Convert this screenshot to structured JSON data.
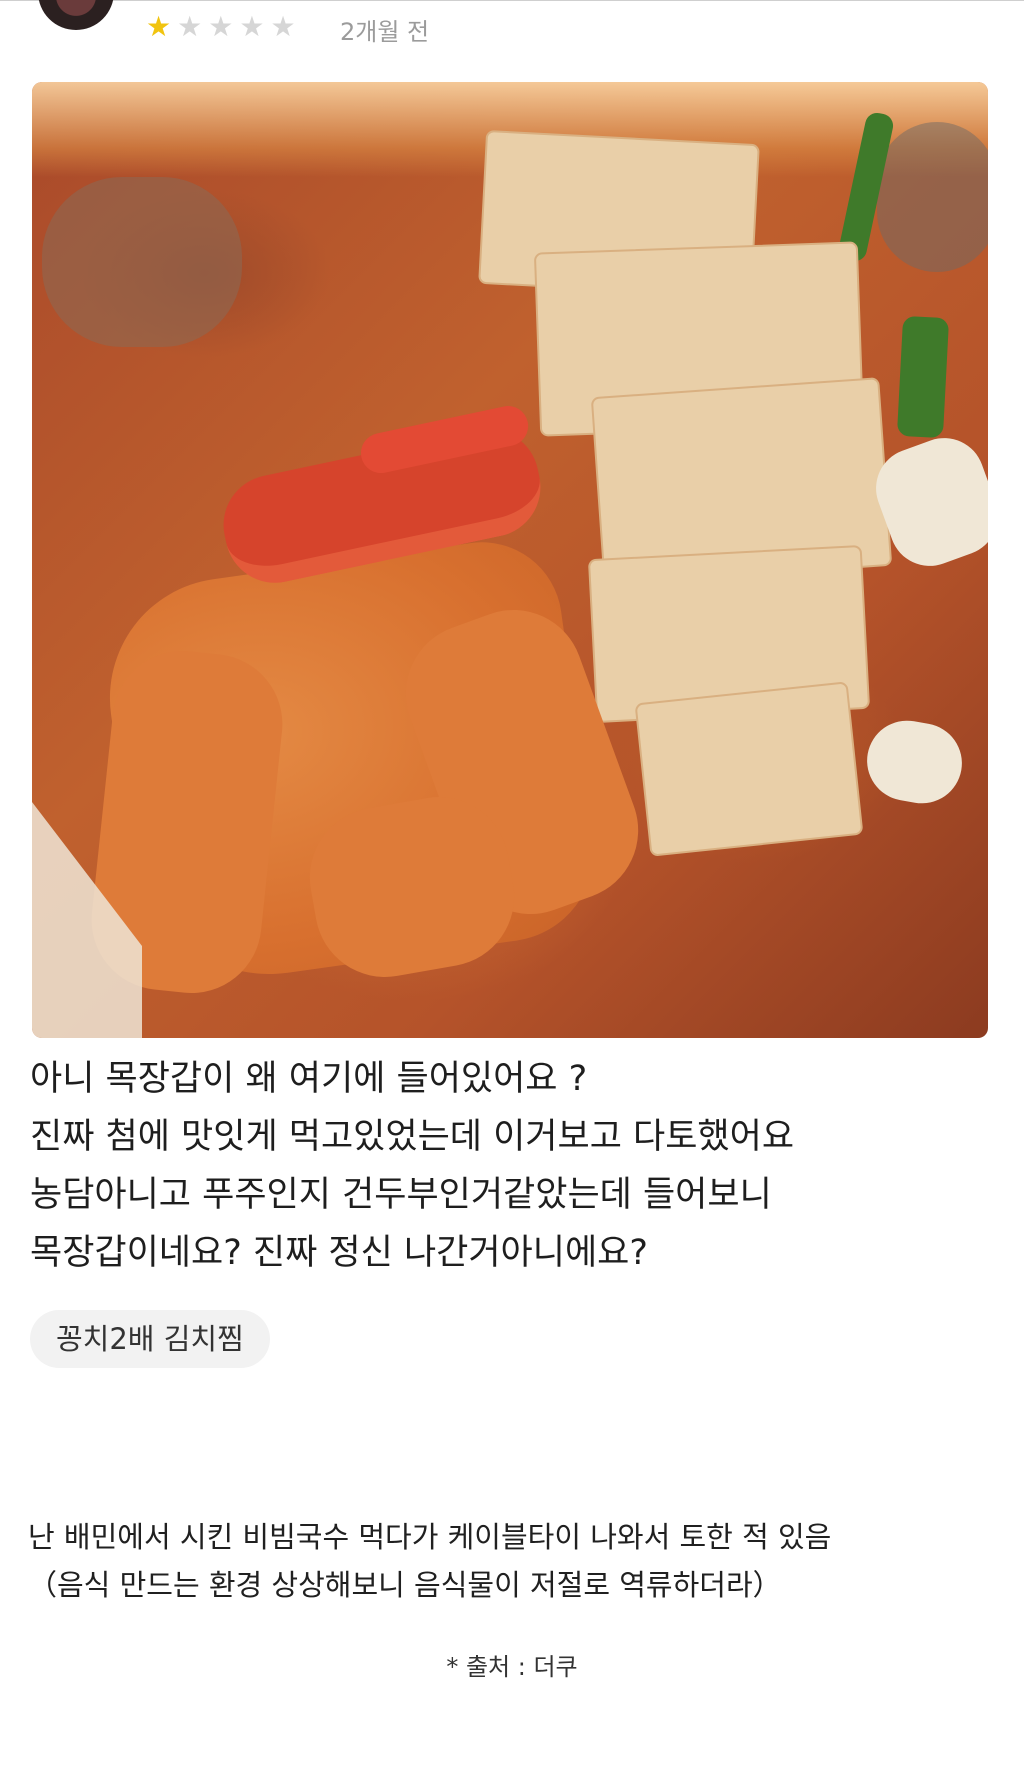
{
  "review_header": {
    "rating": 1,
    "max_rating": 5,
    "time_ago": "2개월 전"
  },
  "review": {
    "lines": [
      "아니 목장갑이 왜 여기에 들어있어요 ?",
      "진짜 첨에 맛잇게 먹고있었는데 이거보고 다토했어요",
      "농담아니고 푸주인지 건두부인거같았는데 들어보니",
      "목장갑이네요?  진짜 정신 나간거아니에요?"
    ],
    "menu_tag": "꽁치2배 김치찜"
  },
  "comment": {
    "lines": [
      "난 배민에서 시킨 비빔국수 먹다가 케이블타이 나와서 토한 적 있음",
      "（음식 만드는 환경 상상해보니 음식물이 저절로 역류하더라）"
    ]
  },
  "source": "* 출처 : 더쿠",
  "colors": {
    "star_on": "#f1c40f",
    "star_off": "#d6d6d6",
    "tag_bg": "#f2f2f2"
  }
}
